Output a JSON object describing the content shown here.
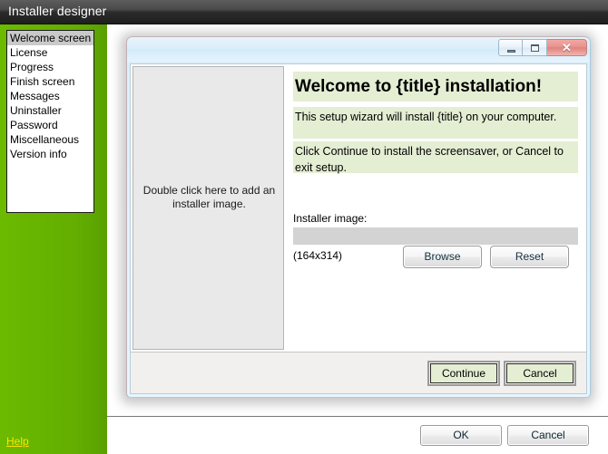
{
  "window": {
    "title": "Installer designer"
  },
  "sidebar": {
    "items": [
      {
        "label": "Welcome screen",
        "selected": true
      },
      {
        "label": "License",
        "selected": false
      },
      {
        "label": "Progress",
        "selected": false
      },
      {
        "label": "Finish screen",
        "selected": false
      },
      {
        "label": "Messages",
        "selected": false
      },
      {
        "label": "Uninstaller",
        "selected": false
      },
      {
        "label": "Password",
        "selected": false
      },
      {
        "label": "Miscellaneous",
        "selected": false
      },
      {
        "label": "Version info",
        "selected": false
      }
    ],
    "help_link": "Help"
  },
  "bottom_bar": {
    "ok_label": "OK",
    "cancel_label": "Cancel"
  },
  "preview_dialog": {
    "titlebar": {
      "minimize_icon": "minimize-icon",
      "maximize_icon": "maximize-icon",
      "close_icon": "close-icon",
      "close_glyph": "✕"
    },
    "image_placeholder": "Double click here to add an installer image.",
    "heading": "Welcome to {title} installation!",
    "line1": "This setup wizard will install {title} on your computer.",
    "line2": "Click Continue to install the screensaver, or Cancel to exit setup.",
    "installer_image_label": "Installer image:",
    "installer_image_value": "",
    "installer_image_placeholder": "",
    "dimensions": "(164x314)",
    "browse_label": "Browse",
    "reset_label": "Reset",
    "continue_label": "Continue",
    "cancel_label": "Cancel"
  },
  "colors": {
    "sidebar_green": "#63ae00",
    "accent_green_box": "#e4eed3",
    "help_link_yellow": "#ffe400",
    "selection_gray": "#c9c9c9",
    "titlebar_dark": "#2b2b2b"
  }
}
